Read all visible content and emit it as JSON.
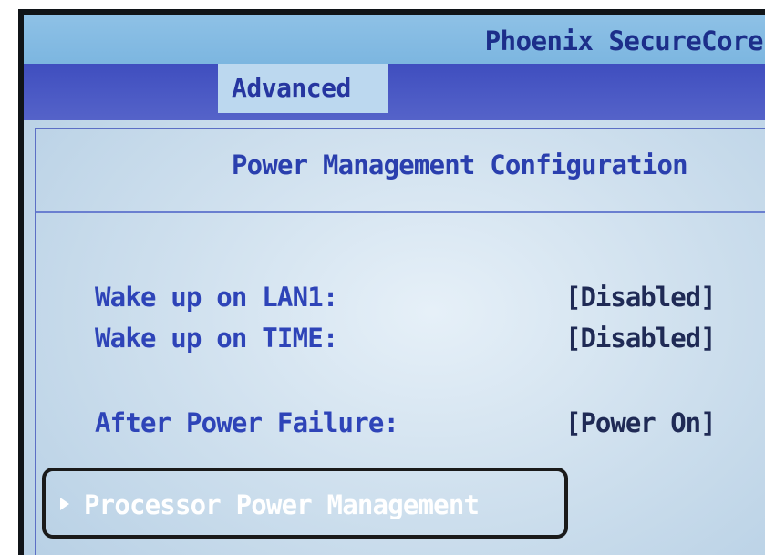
{
  "window": {
    "title": "Phoenix SecureCore"
  },
  "tabs": {
    "active_label": "Advanced"
  },
  "page": {
    "heading": "Power Management Configuration"
  },
  "settings": [
    {
      "label": "Wake up on LAN1:",
      "value": "[Disabled]"
    },
    {
      "label": "Wake up on TIME:",
      "value": "[Disabled]"
    },
    {
      "label": "After Power Failure:",
      "value": "[Power On]"
    }
  ],
  "submenu": {
    "label": "Processor Power Management",
    "icon": "triangle-right-icon"
  },
  "colors": {
    "title_bar": "#7cb6e0",
    "tab_bar": "#4a59c4",
    "active_tab": "#bcd8ef",
    "label_text": "#2e44b8",
    "value_text": "#1f2a55",
    "selected_text": "#ffffff"
  }
}
